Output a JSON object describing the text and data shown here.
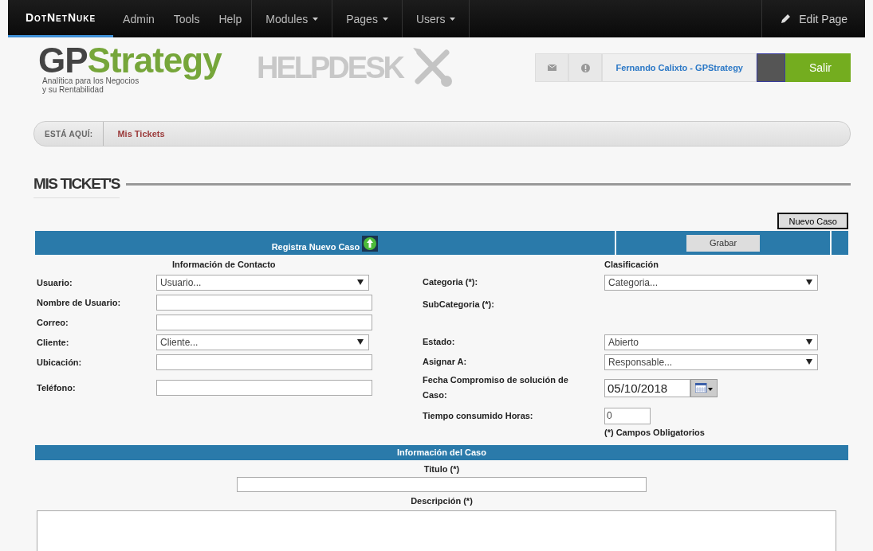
{
  "nav": {
    "logo": "DotNetNuke",
    "items": [
      {
        "label": "Admin",
        "kind": "link"
      },
      {
        "label": "Tools",
        "kind": "link"
      },
      {
        "label": "Help",
        "kind": "link"
      },
      {
        "label": "Modules",
        "kind": "dropdown"
      },
      {
        "label": "Pages",
        "kind": "dropdown"
      },
      {
        "label": "Users",
        "kind": "dropdown"
      }
    ],
    "edit": "Edit Page"
  },
  "header": {
    "brand_dark": "GP",
    "brand_light": "Strategy",
    "tagline": "Analítica para los Negocios\ny su Rentabilidad",
    "app": "HELPDESK",
    "user": "Fernando Calixto - GPStrategy",
    "logout": "Salir"
  },
  "breadcrumb": {
    "label": "ESTÁ AQUÍ:",
    "current": "Mis Tickets"
  },
  "page_title": "MIS TICKET'S",
  "new_case_button": "Nuevo Caso",
  "form_bar": {
    "title": "Registra Nuevo Caso",
    "save": "Grabar"
  },
  "contact": {
    "heading": "Información de Contacto",
    "fields": [
      {
        "label": "Usuario:",
        "kind": "select",
        "value": "Usuario..."
      },
      {
        "label": "Nombre de Usuario:",
        "kind": "text"
      },
      {
        "label": "Correo:",
        "kind": "text"
      },
      {
        "label": "Cliente:",
        "kind": "select",
        "value": "Cliente..."
      },
      {
        "label": "Ubicación:",
        "kind": "text"
      },
      {
        "label": "Teléfono:",
        "kind": "text-tall"
      }
    ]
  },
  "classification": {
    "heading": "Clasificación",
    "fields": [
      {
        "label": "Categoria (*):",
        "kind": "select",
        "value": "Categoria..."
      },
      {
        "label": "SubCategoria (*):",
        "kind": "none"
      },
      {
        "label": "Estado:",
        "kind": "select",
        "value": "Abierto"
      },
      {
        "label": "Asignar A:",
        "kind": "select",
        "value": "Responsable..."
      },
      {
        "label": "Fecha Compromiso de solución de Caso:",
        "kind": "date",
        "value": "05/10/2018"
      },
      {
        "label": "Tiempo consumido Horas:",
        "kind": "number",
        "value": "0"
      }
    ],
    "note": "(*) Campos Obligatorios"
  },
  "case_info": {
    "title": "Información del Caso",
    "title_label": "Titulo (*)",
    "description_label": "Descripción (*)"
  }
}
